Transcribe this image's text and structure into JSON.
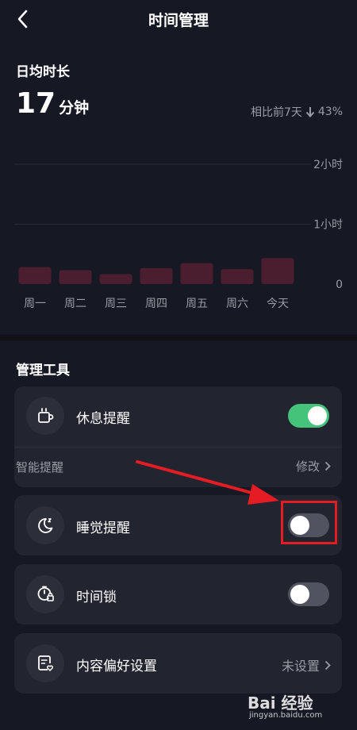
{
  "header": {
    "title": "时间管理"
  },
  "stats": {
    "daily_label": "日均时长",
    "daily_value": "17",
    "daily_unit": "分钟",
    "compare_text": "相比前7天",
    "compare_value": "43%"
  },
  "chart_data": {
    "type": "bar",
    "categories": [
      "周一",
      "周二",
      "周三",
      "周四",
      "周五",
      "周六",
      "今天"
    ],
    "values": [
      17,
      14,
      10,
      16,
      21,
      15,
      26
    ],
    "yticks": [
      "2小时",
      "1小时",
      "0"
    ],
    "ylim": [
      0,
      120
    ],
    "grid": true,
    "bar_color": "#4a1e2e"
  },
  "tools": {
    "section_title": "管理工具",
    "rest": {
      "label": "休息提醒",
      "on": true,
      "sub_label": "智能提醒",
      "sub_action": "修改"
    },
    "sleep": {
      "label": "睡觉提醒",
      "on": false
    },
    "lock": {
      "label": "时间锁",
      "on": false
    },
    "content": {
      "label": "内容偏好设置",
      "action": "未设置"
    }
  },
  "watermark": {
    "text": "Bai 经验",
    "sub": "jingyan.baidu.com"
  },
  "colors": {
    "background": "#161823",
    "card": "#222430",
    "toggle_on": "#46c37b",
    "toggle_off": "#515360",
    "annotation": "#e51c23"
  }
}
